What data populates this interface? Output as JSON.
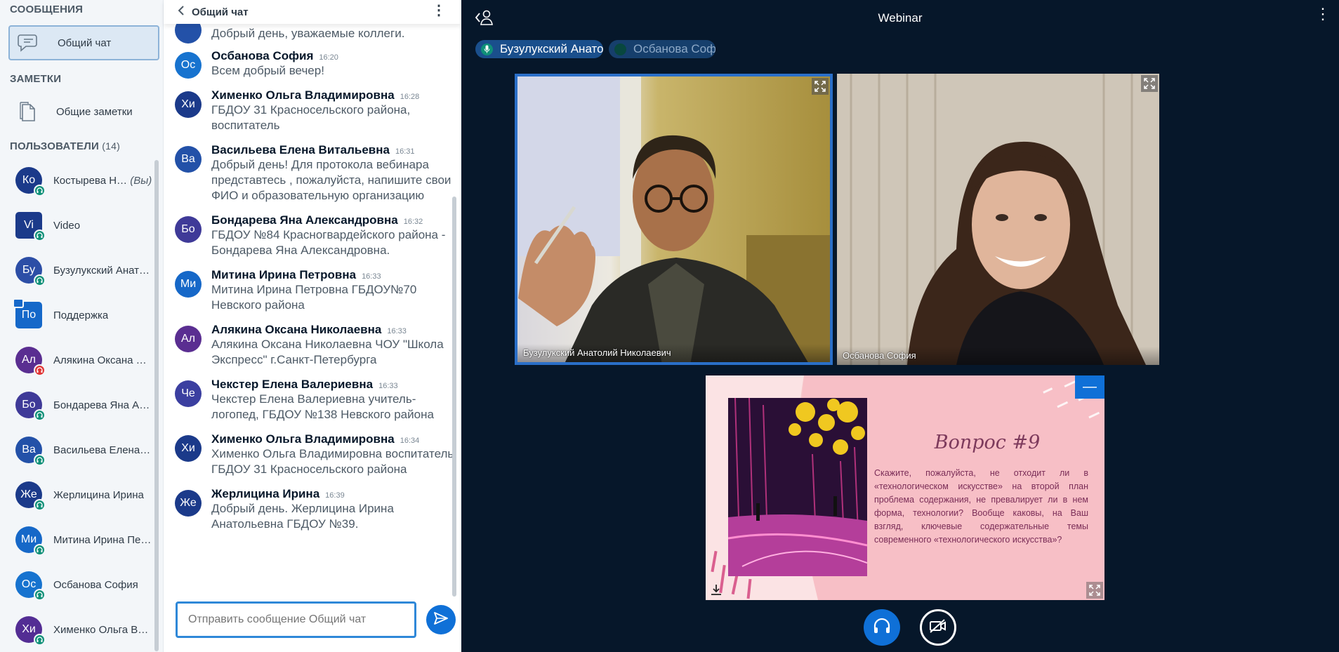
{
  "left_panel": {
    "messages_title": "СООБЩЕНИЯ",
    "public_chat_label": "Общий чат",
    "notes_title": "ЗАМЕТКИ",
    "shared_notes_label": "Общие заметки",
    "users_title": "ПОЛЬЗОВАТЕЛИ",
    "users_count": "(14)",
    "users": [
      {
        "initials": "Ко",
        "name": "Костырева Н…",
        "suffix": "(Вы)",
        "color": "#1b3a8a",
        "mic": "#0f9078"
      },
      {
        "initials": "Vi",
        "name": "Video",
        "suffix": "",
        "color": "#1b3a8a",
        "mic": "#0f9078"
      },
      {
        "initials": "Бу",
        "name": "Бузулукский Анат…",
        "suffix": "",
        "color": "#2c4ea6",
        "mic": "#0f9078"
      },
      {
        "initials": "По",
        "name": "Поддержка",
        "suffix": "",
        "color": "#1568c9",
        "mic": ""
      },
      {
        "initials": "Ал",
        "name": "Алякина Оксана …",
        "suffix": "",
        "color": "#5a2e91",
        "mic": "#e03535"
      },
      {
        "initials": "Бо",
        "name": "Бондарева Яна А…",
        "suffix": "",
        "color": "#3f3a98",
        "mic": "#0f9078"
      },
      {
        "initials": "Ва",
        "name": "Васильева Елена…",
        "suffix": "",
        "color": "#2351a8",
        "mic": "#0f9078"
      },
      {
        "initials": "Же",
        "name": "Жерлицина Ирина",
        "suffix": "",
        "color": "#1b3a8a",
        "mic": "#0f9078"
      },
      {
        "initials": "Ми",
        "name": "Митина Ирина Пе…",
        "suffix": "",
        "color": "#1668c8",
        "mic": "#0f9078"
      },
      {
        "initials": "Ос",
        "name": "Осбанова София",
        "suffix": "",
        "color": "#1773cf",
        "mic": "#0f9078"
      },
      {
        "initials": "Хи",
        "name": "Хименко Ольга В…",
        "suffix": "",
        "color": "#532d94",
        "mic": "#0f9078"
      }
    ]
  },
  "chat": {
    "title": "Общий чат",
    "input_placeholder": "Отправить сообщение Общий чат",
    "partial_top_message": "Добрый день, уважаемые коллеги.",
    "messages": [
      {
        "initials": "Ос",
        "color": "#1773cf",
        "name": "Осбанова София",
        "time": "16:20",
        "text": "Всем добрый вечер!"
      },
      {
        "initials": "Хи",
        "color": "#1b3a8a",
        "name": "Хименко Ольга Владимировна",
        "time": "16:28",
        "text": "ГБДОУ 31 Красносельского района, воспитатель"
      },
      {
        "initials": "Ва",
        "color": "#2351a8",
        "name": "Васильева Елена Витальевна",
        "time": "16:31",
        "text": "Добрый день! Для протокола вебинара представтесь , пожалуйста, напишите свои ФИО и образовательную организацию"
      },
      {
        "initials": "Бо",
        "color": "#3f3a98",
        "name": "Бондарева Яна Александровна",
        "time": "16:32",
        "text": "ГБДОУ №84 Красногвардейского района - Бондарева Яна Александровна."
      },
      {
        "initials": "Ми",
        "color": "#1668c8",
        "name": "Митина Ирина Петровна",
        "time": "16:33",
        "text": "Митина Ирина Петровна ГБДОУ№70 Невского района"
      },
      {
        "initials": "Ал",
        "color": "#5a2e91",
        "name": "Алякина Оксана Николаевна",
        "time": "16:33",
        "text": "Алякина Оксана Николаевна ЧОУ \"Школа Экспресс\" г.Санкт-Петербурга"
      },
      {
        "initials": "Че",
        "color": "#3b3fa0",
        "name": "Чекстер Елена Валериевна",
        "time": "16:33",
        "text": "Чекстер Елена Валериевна учитель-логопед, ГБДОУ №138 Невского района"
      },
      {
        "initials": "Хи",
        "color": "#1b3a8a",
        "name": "Хименко Ольга Владимировна",
        "time": "16:34",
        "text": "Хименко Ольга Владимировна воспитатель ГБДОУ 31 Красносельского района"
      },
      {
        "initials": "Же",
        "color": "#1b3a8a",
        "name": "Жерлицина Ирина",
        "time": "16:39",
        "text": "Добрый день. Жерлицина Ирина Анатольевна ГБДОУ №39."
      }
    ]
  },
  "main": {
    "title": "Webinar",
    "talkers": [
      "Бузулукский Анато…",
      "Осбанова София"
    ],
    "videos": [
      {
        "label": "Бузулукский Анатолий Николаевич"
      },
      {
        "label": "Осбанова София"
      }
    ],
    "slide": {
      "title": "Вопрос #9",
      "text": "Скажите, пожалуйста, не отходит ли в «технологическом искусстве» на второй план проблема содержания, не превалирует ли в нем форма, технологии? Вообще каковы, на Ваш взгляд, ключевые содержательные темы современного «технологического искусства»?",
      "minimize_label": "—"
    }
  },
  "colors": {
    "accent": "#0f70d7",
    "background": "#06172a",
    "mic_on": "#0f9078",
    "mic_off": "#e03535"
  }
}
